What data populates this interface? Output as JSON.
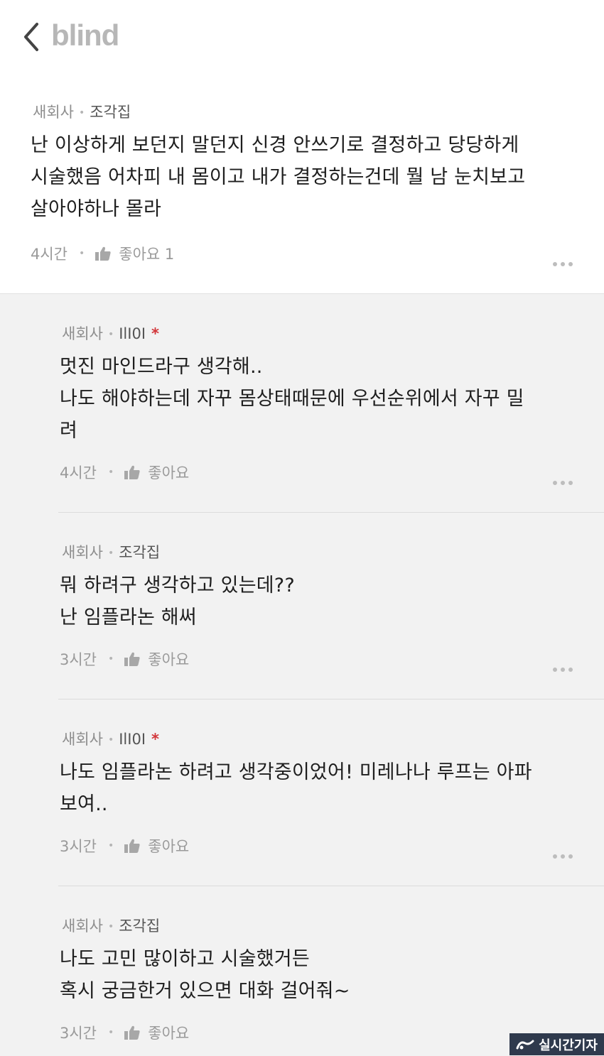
{
  "header": {
    "logo_text": "blind"
  },
  "main_comment": {
    "company": "새회사",
    "nickname": "조각집",
    "text": "난 이상하게 보던지 말던지 신경 안쓰기로 결정하고 당당하게\n시술했음 어차피 내 몸이고 내가 결정하는건데 뭘 남 눈치보고\n살아야하나 몰라",
    "time": "4시간",
    "like_label": "좋아요 1"
  },
  "replies": [
    {
      "company": "새회사",
      "nickname": "IlI0I",
      "author_mark": "*",
      "text": "멋진 마인드라구 생각해..\n나도 해야하는데 자꾸 몸상태때문에 우선순위에서 자꾸 밀\n려",
      "time": "4시간",
      "like_label": "좋아요"
    },
    {
      "company": "새회사",
      "nickname": "조각집",
      "text": "뭐 하려구 생각하고 있는데??\n난 임플라논 해써",
      "time": "3시간",
      "like_label": "좋아요"
    },
    {
      "company": "새회사",
      "nickname": "IlI0I",
      "author_mark": "*",
      "text": "나도 임플라논 하려고 생각중이었어! 미레나나 루프는 아파\n보여..",
      "time": "3시간",
      "like_label": "좋아요"
    },
    {
      "company": "새회사",
      "nickname": "조각집",
      "text": "나도 고민 많이하고 시술했거든\n혹시 궁금한거 있으면 대화 걸어줘~",
      "time": "3시간",
      "like_label": "좋아요"
    }
  ],
  "watermark": {
    "text": "실시간기자"
  },
  "colors": {
    "background_replies": "#f2f2f2",
    "author_mark": "#d2363a",
    "watermark_bg": "#2f3a4d"
  }
}
